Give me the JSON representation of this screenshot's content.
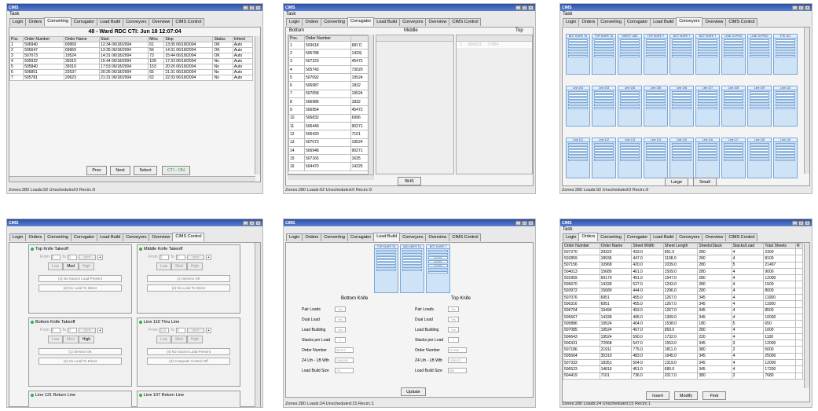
{
  "common": {
    "app_title": "CIMS",
    "menu": "Task",
    "tabs": [
      "Login",
      "Orders",
      "Converting",
      "Corrugator",
      "Load Build",
      "Conveyors",
      "Overview",
      "CIMS Control"
    ]
  },
  "win1": {
    "header": "48 - Ward RDC    CTI: Jun 18 12:07:04",
    "columns": [
      "Pos",
      "Order Number",
      "Order Name",
      "Start",
      "Mins",
      "Stop",
      "Status",
      "Infeed"
    ],
    "rows": [
      [
        "1",
        "506940",
        "69959",
        "12:34  06/18/2004",
        "61",
        "13:35  06/18/2004",
        "OK",
        "Auto"
      ],
      [
        "2",
        "505647",
        "69960",
        "13:35  06/18/2004",
        "56",
        "14:31  06/18/2004",
        "OK",
        "Auto"
      ],
      [
        "3",
        "507073",
        "19524",
        "14:31  06/18/2004",
        "73",
        "15:44  06/18/2004",
        "OK",
        "Auto"
      ],
      [
        "4",
        "505932",
        "39310",
        "15:44  06/18/2004",
        "109",
        "17:33  06/18/2004",
        "No",
        "Auto"
      ],
      [
        "5",
        "505840",
        "39310",
        "17:53  06/18/2004",
        "153",
        "20:26  06/18/2004",
        "No",
        "Auto"
      ],
      [
        "6",
        "506851",
        "22637",
        "20:26  06/18/2004",
        "65",
        "21:31  06/18/2004",
        "No",
        "Auto"
      ],
      [
        "7",
        "505781",
        "20623",
        "21:31  06/18/2004",
        "62",
        "22:33  06/18/2004",
        "No",
        "Auto"
      ]
    ],
    "btn_prev": "Prev",
    "btn_next": "Next",
    "btn_select": "Select",
    "btn_cti": "CTI - ON",
    "status": "Zones:280 Loads:92 Unscheduled:0 Recirc:9"
  },
  "win2": {
    "section_bottom": "Bottom",
    "section_middle": "Middle",
    "section_top": "Top",
    "columns": [
      "Pos.",
      "Order Number"
    ],
    "rows": [
      [
        "1",
        "503618",
        "6817("
      ],
      [
        "2",
        "505788",
        "1433("
      ],
      [
        "3",
        "507223",
        "45472"
      ],
      [
        "4",
        "505743",
        "73020"
      ],
      [
        "5",
        "507092",
        "19524"
      ],
      [
        "6",
        "506987",
        "1832"
      ],
      [
        "7",
        "507058",
        "19524"
      ],
      [
        "8",
        "506986",
        "1832"
      ],
      [
        "9",
        "506954",
        "45472"
      ],
      [
        "10",
        "506832",
        "6996"
      ],
      [
        "11",
        "506449",
        "90271"
      ],
      [
        "12",
        "506420",
        "7101"
      ],
      [
        "13",
        "507073",
        "19524"
      ],
      [
        "14",
        "506948",
        "90271"
      ],
      [
        "15",
        "507165",
        "1635"
      ],
      [
        "16",
        "504470",
        "14225"
      ]
    ],
    "top_row": [
      "1",
      "506913",
      "77454"
    ],
    "btn": "BHS",
    "status": "Zones:280 Loads:92 Unscheduled:0 Recirc:9"
  },
  "win3": {
    "row1": [
      "BOT KNIFE TA",
      "TOP KNIFE TA",
      "SHEET LINE",
      "TOP KNIFE T",
      "BOT KNIFE T",
      "BOT KNIFE T",
      "LINE 14 PRIO",
      "LINE 15 PRIO",
      "FTE 101"
    ],
    "row2": [
      "Line 104",
      "Line 103",
      "Line 106",
      "Line 105",
      "Line 106",
      "Line 107",
      "Line 108",
      "Line 109",
      "Line 110"
    ],
    "row3": [
      "Line 111",
      "Line 112",
      "Line 113",
      "Line 114",
      "Line 115",
      "Line 116",
      "Line 117",
      "Line 118",
      "Line 119"
    ],
    "btn_large": "Large",
    "btn_small": "Small",
    "status": "Zones:280 Loads:92 Unscheduled:0 Recirc:9"
  },
  "win4": {
    "groups": [
      {
        "title": "Top Knife Takeoff",
        "from": "0",
        "to": "0",
        "off": "OFF",
        "lvl": [
          "Low",
          "Med",
          "High"
        ],
        "info1": "(4) No Source Load Present",
        "info2": "(4) No Load To Direct"
      },
      {
        "title": "Middle Knife Takeoff",
        "from": "0",
        "to": "0",
        "off": "OFF",
        "lvl": [
          "Low",
          "Med",
          "High"
        ],
        "info1": "(1) Service OK",
        "info2": "(4) No Load To Direct"
      },
      {
        "title": "Bottom Knife Takeoff",
        "from": "0",
        "to": "0",
        "off": "OFF",
        "lvl": [
          "Low",
          "Med",
          "High"
        ],
        "info1": "(1) Service OK",
        "info2": "(4) No Load To Direct"
      },
      {
        "title": "Line 110 Thru Line",
        "from": "116",
        "to": "0",
        "off": "OFF",
        "lvl": [
          "Low",
          "Med",
          "High"
        ],
        "info1": "(4) No Source Load Present",
        "info2": "(2) Computer Control Off"
      }
    ],
    "from_label": "From",
    "to_label": "To",
    "plus": "+",
    "g5": "Line 121 Return Line",
    "g6": "Line 107 Return Line"
  },
  "win5": {
    "lanes": [
      "TOP KNIFE TA",
      "MID KNIFE TA",
      "BOT KNIFE T"
    ],
    "lane3_items": [
      "507182",
      "507381",
      "507395"
    ],
    "bottom_title": "Bottom Knife",
    "top_title": "Top Knife",
    "labels": [
      "Pair Loads",
      "Dual Load",
      "Load Building",
      "Stacks per Load",
      "Order Number",
      "Z4 Lth - LB Wth",
      "Load Build Size"
    ],
    "bottom_vals": [
      "Yes",
      "Yes",
      "Yes",
      "1",
      "507073",
      "1366  693",
      "711"
    ],
    "top_vals": [
      "Yes",
      "Yes",
      "Yes",
      "1",
      "507058",
      "1535  971",
      "885"
    ],
    "btn": "Update",
    "status": "Zones:280 Loads:24 Unscheduled:15 Recirc:1"
  },
  "win6": {
    "columns": [
      "Order Number",
      "Order Name",
      "Sheet Width",
      "Sheet Length",
      "Sheets/Stack",
      "Stacks/Load",
      "Total Sheets",
      "R"
    ],
    "rows": [
      [
        "507270",
        "29322",
        "433.0",
        "951.0",
        "280",
        "4",
        "2300"
      ],
      [
        "502859",
        "18936",
        "447.0",
        "1198.0",
        "280",
        "4",
        "8100"
      ],
      [
        "507156",
        "10968",
        "420.0",
        "1039.0",
        "280",
        "5",
        "21497"
      ],
      [
        "504013",
        "15680",
        "461.0",
        "1509.0",
        "280",
        "4",
        "9000"
      ],
      [
        "502959",
        "69170",
        "491.0",
        "1547.0",
        "280",
        "4",
        "12000"
      ],
      [
        "505670",
        "14339",
        "527.0",
        "1243.0",
        "280",
        "4",
        "1500"
      ],
      [
        "503972",
        "15680",
        "444.0",
        "1296.0",
        "280",
        "4",
        "8000"
      ],
      [
        "507076",
        "6951",
        "455.0",
        "1267.0",
        "345",
        "4",
        "11000"
      ],
      [
        "506316",
        "6951",
        "455.0",
        "1267.0",
        "345",
        "4",
        "11000"
      ],
      [
        "506704",
        "19494",
        "493.0",
        "1267.0",
        "345",
        "4",
        "8500"
      ],
      [
        "505667",
        "14339",
        "495.0",
        "1309.0",
        "345",
        "4",
        "10000"
      ],
      [
        "505886",
        "19524",
        "404.0",
        "1538.0",
        "180",
        "5",
        "650"
      ],
      [
        "507085",
        "19524",
        "467.0",
        "969.0",
        "280",
        "4",
        "1000"
      ],
      [
        "506643",
        "19524",
        "590.0",
        "1732.0",
        "220",
        "4",
        "1100"
      ],
      [
        "506331",
        "72968",
        "547.0",
        "1553.0",
        "345",
        "3",
        "12000"
      ],
      [
        "507186",
        "21911",
        "775.0",
        "1811.0",
        "380",
        "2",
        "5000"
      ],
      [
        "505664",
        "35310",
        "483.0",
        "1645.0",
        "345",
        "4",
        "25000"
      ],
      [
        "507333",
        "18351",
        "504.0",
        "1319.0",
        "345",
        "4",
        "12000"
      ],
      [
        "506523",
        "14819",
        "451.0",
        "680.0",
        "345",
        "4",
        "17200"
      ],
      [
        "504419",
        "7101",
        "736.0",
        "2017.0",
        "380",
        "2",
        "7680"
      ]
    ],
    "btn_insert": "Insert",
    "btn_modify": "Modify",
    "btn_find": "Find",
    "status": "Zones:280 Loads:24 Unscheduled:15 Recirc:1"
  }
}
